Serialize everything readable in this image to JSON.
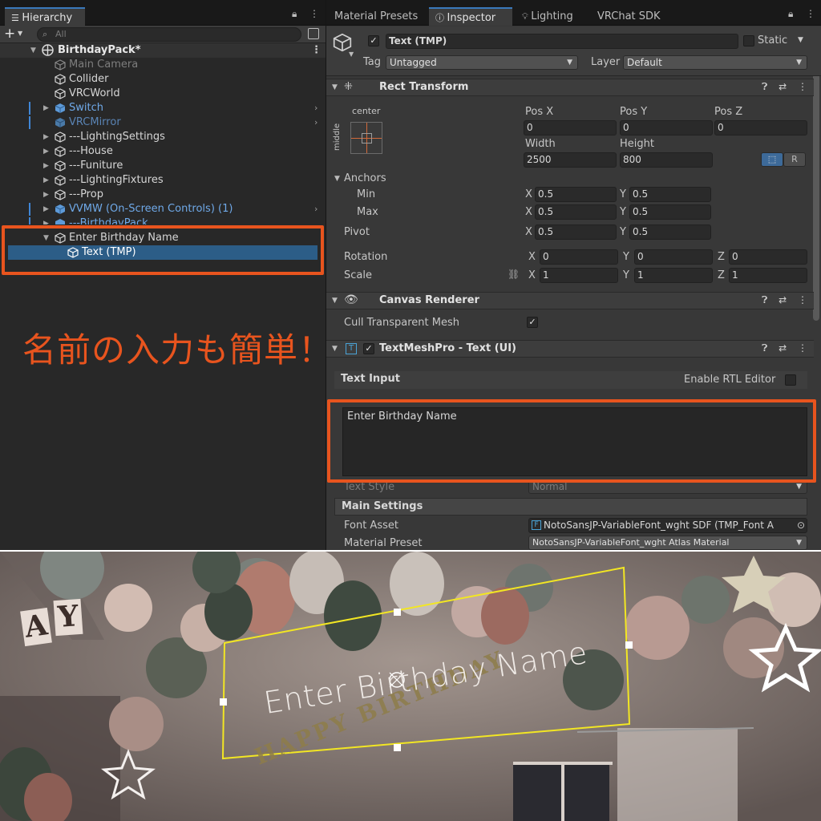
{
  "hierarchy": {
    "tab_label": "Hierarchy",
    "search_placeholder": "All",
    "scene_name": "BirthdayPack*",
    "items": [
      {
        "label": "Main Camera"
      },
      {
        "label": "Collider"
      },
      {
        "label": "VRCWorld"
      },
      {
        "label": "Switch"
      },
      {
        "label": "VRCMirror"
      },
      {
        "label": "---LightingSettings"
      },
      {
        "label": "---House"
      },
      {
        "label": "---Funiture"
      },
      {
        "label": "---LightingFixtures"
      },
      {
        "label": "---Prop"
      },
      {
        "label": "VVMW (On-Screen Controls) (1)"
      },
      {
        "label": "---BirthdayPack"
      },
      {
        "label": "Enter Birthday Name"
      },
      {
        "label": "Text (TMP)"
      }
    ]
  },
  "annotation": {
    "text": "名前の入力も簡単！",
    "color": "#e8541e"
  },
  "inspector": {
    "tabs": [
      "Material Presets",
      "Inspector",
      "Lighting",
      "VRChat SDK"
    ],
    "object_name": "Text (TMP)",
    "static_label": "Static",
    "tag_label": "Tag",
    "tag_value": "Untagged",
    "layer_label": "Layer",
    "layer_value": "Default",
    "rect_transform": {
      "title": "Rect Transform",
      "anchor_h": "center",
      "anchor_v": "middle",
      "pos_x_label": "Pos X",
      "pos_x": "0",
      "pos_y_label": "Pos Y",
      "pos_y": "0",
      "pos_z_label": "Pos Z",
      "pos_z": "0",
      "width_label": "Width",
      "width": "2500",
      "height_label": "Height",
      "height": "800",
      "r_button": "R",
      "anchors_label": "Anchors",
      "min_label": "Min",
      "min_x": "0.5",
      "min_y": "0.5",
      "max_label": "Max",
      "max_x": "0.5",
      "max_y": "0.5",
      "pivot_label": "Pivot",
      "pivot_x": "0.5",
      "pivot_y": "0.5",
      "rotation_label": "Rotation",
      "rot_x": "0",
      "rot_y": "0",
      "rot_z": "0",
      "scale_label": "Scale",
      "scale_x": "1",
      "scale_y": "1",
      "scale_z": "1",
      "x": "X",
      "y": "Y",
      "z": "Z"
    },
    "canvas_renderer": {
      "title": "Canvas Renderer",
      "cull_label": "Cull Transparent Mesh"
    },
    "tmp": {
      "title": "TextMeshPro - Text (UI)",
      "text_input_label": "Text Input",
      "rtl_label": "Enable RTL Editor",
      "text_value": "Enter Birthday Name",
      "text_style_label": "Text Style",
      "text_style_value": "Normal",
      "main_settings_label": "Main Settings",
      "font_asset_label": "Font Asset",
      "font_asset_value": "NotoSansJP-VariableFont_wght SDF (TMP_Font A",
      "material_preset_label": "Material Preset",
      "material_preset_value": "NotoSansJP-VariableFont_wght Atlas Material"
    }
  },
  "scene": {
    "tmp_text": "Enter Birthday Name",
    "banner_text": "HAPPY BIRTHDAY",
    "flag_letters": [
      "A",
      "Y"
    ]
  }
}
